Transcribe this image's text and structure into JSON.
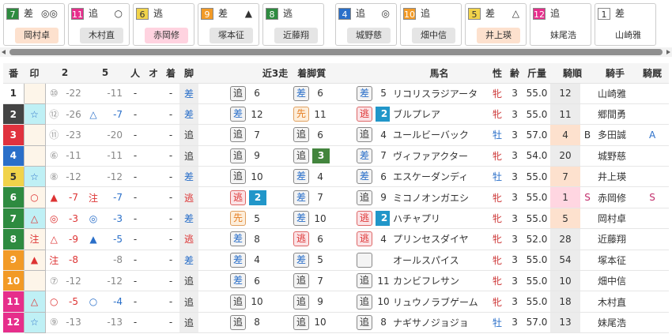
{
  "cards": [
    {
      "no": "7",
      "nocolor": "#2e8b40",
      "style": "差",
      "mark": "◎◎",
      "jockey": "岡村卓",
      "jcolor": "#fde1ce"
    },
    {
      "no": "11",
      "nocolor": "#e62e8b",
      "style": "追",
      "mark": "○",
      "jockey": "木村直",
      "jcolor": "#e5e5e5"
    },
    {
      "no": "6",
      "nocolor": "#f1d34a",
      "style": "逃",
      "mark": "",
      "jockey": "赤岡修",
      "jcolor": "#ffd3e0"
    },
    {
      "no": "9",
      "nocolor": "#f29a26",
      "style": "差",
      "mark": "▲",
      "jockey": "塚本征",
      "jcolor": "#e5e5e5"
    },
    {
      "no": "8",
      "nocolor": "#2e8b40",
      "style": "逃",
      "mark": "",
      "jockey": "近藤翔",
      "jcolor": "#e5e5e5"
    },
    {
      "no": "4",
      "nocolor": "#2a6fc9",
      "style": "追",
      "mark": "◎",
      "jockey": "城野慈",
      "jcolor": "#e5e5e5"
    },
    {
      "no": "10",
      "nocolor": "#f29a26",
      "style": "追",
      "mark": "",
      "jockey": "畑中信",
      "jcolor": "#e5e5e5"
    },
    {
      "no": "5",
      "nocolor": "#f1d34a",
      "style": "差",
      "mark": "△",
      "jockey": "井上瑛",
      "jcolor": "#fde1ce"
    },
    {
      "no": "12",
      "nocolor": "#e62e8b",
      "style": "追",
      "mark": "",
      "jockey": "妹尾浩",
      "jcolor": "#fff"
    },
    {
      "no": "1",
      "nocolor": "#fff",
      "style": "差",
      "mark": "",
      "jockey": "山崎雅",
      "jcolor": "#fff"
    }
  ],
  "headers": {
    "no": "番",
    "mark": "印",
    "m2": "2",
    "m5": "5",
    "hito": "人",
    "o": "オ",
    "chaku": "着",
    "kyaku": "脚",
    "kin3": "近3走　着脚質",
    "name": "馬名",
    "sex": "性",
    "age": "齢",
    "weight": "斤量",
    "pop": "騎順",
    "jockey": "騎手",
    "stable": "騎厩"
  },
  "rows": [
    {
      "no": "1",
      "nocolor": "#fff",
      "nofg": "#333",
      "mark": "",
      "m2a": "",
      "m2b": "⑩",
      "m2c": "-22",
      "m5a": "",
      "m5b": "-11",
      "hito": "-",
      "o": "",
      "chaku": "-",
      "kyaku": "差",
      "kycol": "#2a6fc9",
      "r1s": "追",
      "r1p": "6",
      "r2s": "差",
      "r2p": "6",
      "r3s": "差",
      "r3p": "5",
      "name": "リコリスラジアータ",
      "sex": "牝",
      "age": "3",
      "weight": "55.0",
      "pop": "12",
      "popc": "#ececec",
      "flag": "",
      "jockey": "山崎雅",
      "stable": ""
    },
    {
      "no": "2",
      "nocolor": "#444",
      "nofg": "#fff",
      "mark": "☆",
      "m2a": "",
      "m2b": "⑫",
      "m2c": "-26",
      "m5a": "△",
      "m5b": "-7",
      "hito": "-",
      "o": "",
      "chaku": "-",
      "kyaku": "差",
      "kycol": "#2a6fc9",
      "r1s": "差",
      "r1p": "12",
      "r2s": "先",
      "r2p": "11",
      "r3s": "逃",
      "r3p": "2",
      "name": "ブルプレア",
      "sex": "牝",
      "age": "3",
      "weight": "55.0",
      "pop": "11",
      "popc": "#ececec",
      "flag": "",
      "jockey": "郷間勇",
      "stable": ""
    },
    {
      "no": "3",
      "nocolor": "#e0323e",
      "nofg": "#fff",
      "mark": "",
      "m2a": "",
      "m2b": "⑪",
      "m2c": "-23",
      "m5a": "",
      "m5b": "-20",
      "hito": "-",
      "o": "",
      "chaku": "-",
      "kyaku": "追",
      "kycol": "#333",
      "r1s": "追",
      "r1p": "7",
      "r2s": "追",
      "r2p": "6",
      "r3s": "追",
      "r3p": "4",
      "name": "ユールビーバック",
      "sex": "牡",
      "age": "3",
      "weight": "57.0",
      "pop": "4",
      "popc": "#fde1ce",
      "flag": "B",
      "jockey": "多田誠",
      "stable": "A"
    },
    {
      "no": "4",
      "nocolor": "#2a6fc9",
      "nofg": "#fff",
      "mark": "",
      "m2a": "",
      "m2b": "⑥",
      "m2c": "-11",
      "m5a": "",
      "m5b": "-11",
      "hito": "-",
      "o": "",
      "chaku": "-",
      "kyaku": "追",
      "kycol": "#333",
      "r1s": "追",
      "r1p": "9",
      "r2s": "追",
      "r2p": "3",
      "r3s": "差",
      "r3p": "7",
      "name": "ヴィファアクター",
      "sex": "牝",
      "age": "3",
      "weight": "54.0",
      "pop": "20",
      "popc": "#ececec",
      "flag": "",
      "jockey": "城野慈",
      "stable": ""
    },
    {
      "no": "5",
      "nocolor": "#f1d34a",
      "nofg": "#333",
      "mark": "☆",
      "m2a": "",
      "m2b": "⑧",
      "m2c": "-12",
      "m5a": "",
      "m5b": "-12",
      "hito": "-",
      "o": "",
      "chaku": "-",
      "kyaku": "差",
      "kycol": "#2a6fc9",
      "r1s": "追",
      "r1p": "10",
      "r2s": "差",
      "r2p": "4",
      "r3s": "差",
      "r3p": "6",
      "name": "エスケーダンディ",
      "sex": "牡",
      "age": "3",
      "weight": "55.0",
      "pop": "7",
      "popc": "#fde1ce",
      "flag": "",
      "jockey": "井上瑛",
      "stable": ""
    },
    {
      "no": "6",
      "nocolor": "#2e8b40",
      "nofg": "#fff",
      "mark": "○",
      "m2a": "▲",
      "m2b": "-7",
      "m2c": "",
      "m5a": "注",
      "m5b": "-7",
      "hito": "-",
      "o": "",
      "chaku": "-",
      "kyaku": "逃",
      "kycol": "#d33",
      "r1s": "逃",
      "r1p": "2",
      "r2s": "差",
      "r2p": "7",
      "r3s": "追",
      "r3p": "9",
      "name": "ミコノオンガエシ",
      "sex": "牝",
      "age": "3",
      "weight": "55.0",
      "pop": "1",
      "popc": "#ffd6e1",
      "flag": "S",
      "jockey": "赤岡修",
      "stable": "S"
    },
    {
      "no": "7",
      "nocolor": "#2e8b40",
      "nofg": "#fff",
      "mark": "△",
      "m2a": "◎",
      "m2b": "-3",
      "m2c": "",
      "m5a": "◎",
      "m5b": "-3",
      "hito": "-",
      "o": "",
      "chaku": "-",
      "kyaku": "差",
      "kycol": "#2a6fc9",
      "r1s": "先",
      "r1p": "5",
      "r2s": "差",
      "r2p": "10",
      "r3s": "逃",
      "r3p": "2",
      "name": "ハチャプリ",
      "sex": "牝",
      "age": "3",
      "weight": "55.0",
      "pop": "5",
      "popc": "#fde1ce",
      "flag": "",
      "jockey": "岡村卓",
      "stable": ""
    },
    {
      "no": "8",
      "nocolor": "#2e8b40",
      "nofg": "#fff",
      "mark": "注",
      "m2a": "△",
      "m2b": "-9",
      "m2c": "",
      "m5a": "▲",
      "m5b": "-5",
      "hito": "-",
      "o": "",
      "chaku": "-",
      "kyaku": "逃",
      "kycol": "#d33",
      "r1s": "差",
      "r1p": "8",
      "r2s": "逃",
      "r2p": "6",
      "r3s": "逃",
      "r3p": "4",
      "name": "プリンセスダイヤ",
      "sex": "牝",
      "age": "3",
      "weight": "52.0",
      "pop": "28",
      "popc": "#ececec",
      "flag": "",
      "jockey": "近藤翔",
      "stable": ""
    },
    {
      "no": "9",
      "nocolor": "#f29a26",
      "nofg": "#fff",
      "mark": "▲",
      "m2a": "注",
      "m2b": "-8",
      "m2c": "",
      "m5a": "",
      "m5b": "-8",
      "hito": "-",
      "o": "",
      "chaku": "-",
      "kyaku": "差",
      "kycol": "#2a6fc9",
      "r1s": "差",
      "r1p": "4",
      "r2s": "差",
      "r2p": "5",
      "r3s": "",
      "r3p": "",
      "name": "オールスパイス",
      "sex": "牝",
      "age": "3",
      "weight": "55.0",
      "pop": "54",
      "popc": "#ececec",
      "flag": "",
      "jockey": "塚本征",
      "stable": ""
    },
    {
      "no": "10",
      "nocolor": "#f29a26",
      "nofg": "#fff",
      "mark": "",
      "m2a": "",
      "m2b": "⑦",
      "m2c": "-12",
      "m5a": "",
      "m5b": "-12",
      "hito": "-",
      "o": "",
      "chaku": "-",
      "kyaku": "追",
      "kycol": "#333",
      "r1s": "差",
      "r1p": "6",
      "r2s": "追",
      "r2p": "7",
      "r3s": "追",
      "r3p": "11",
      "name": "カンビフレサン",
      "sex": "牝",
      "age": "3",
      "weight": "55.0",
      "pop": "10",
      "popc": "#ececec",
      "flag": "",
      "jockey": "畑中信",
      "stable": ""
    },
    {
      "no": "11",
      "nocolor": "#e62e8b",
      "nofg": "#fff",
      "mark": "△",
      "m2a": "○",
      "m2b": "-5",
      "m2c": "",
      "m5a": "○",
      "m5b": "-4",
      "hito": "-",
      "o": "",
      "chaku": "-",
      "kyaku": "追",
      "kycol": "#333",
      "r1s": "追",
      "r1p": "10",
      "r2s": "追",
      "r2p": "9",
      "r3s": "追",
      "r3p": "10",
      "name": "リュウノラブゲーム",
      "sex": "牝",
      "age": "3",
      "weight": "55.0",
      "pop": "18",
      "popc": "#ececec",
      "flag": "",
      "jockey": "木村直",
      "stable": ""
    },
    {
      "no": "12",
      "nocolor": "#e62e8b",
      "nofg": "#fff",
      "mark": "☆",
      "m2a": "",
      "m2b": "⑨",
      "m2c": "-13",
      "m5a": "",
      "m5b": "-13",
      "hito": "-",
      "o": "",
      "chaku": "-",
      "kyaku": "追",
      "kycol": "#333",
      "r1s": "追",
      "r1p": "8",
      "r2s": "追",
      "r2p": "10",
      "r3s": "追",
      "r3p": "8",
      "name": "ナギサノジョジョ",
      "sex": "牡",
      "age": "3",
      "weight": "57.0",
      "pop": "13",
      "popc": "#ececec",
      "flag": "",
      "jockey": "妹尾浩",
      "stable": ""
    }
  ],
  "colors": {
    "style_sashi": "#2a6fc9",
    "style_nige": "#d33",
    "style_oi": "#333",
    "style_sen": "#e67e22",
    "badge2": "#2196c9",
    "badge3": "#43853d",
    "badge_red": "#e62e5e"
  }
}
